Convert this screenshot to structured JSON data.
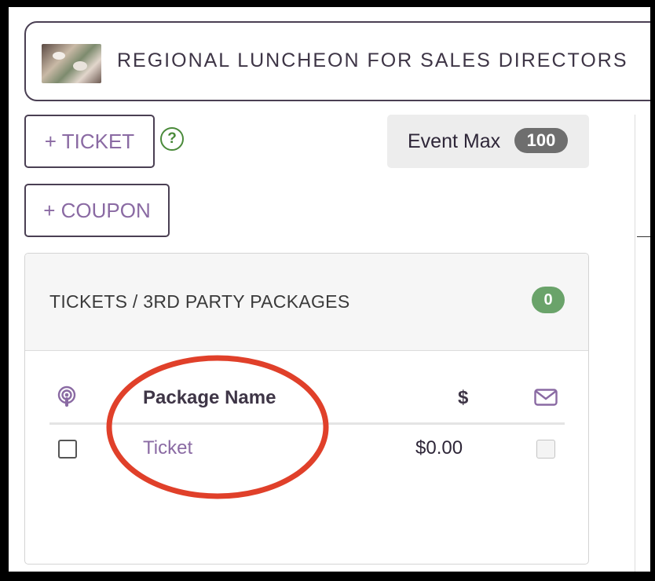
{
  "event": {
    "title": "REGIONAL LUNCHEON FOR SALES DIRECTORS",
    "thumbnail_icon": "event-photo"
  },
  "toolbar": {
    "add_ticket_label": "+ TICKET",
    "add_coupon_label": "+ COUPON",
    "help_label": "?",
    "event_max_label": "Event Max",
    "event_max_value": "100"
  },
  "tickets_panel": {
    "title": "TICKETS / 3RD PARTY PACKAGES",
    "count": "0",
    "columns": {
      "select_icon": "podcast-icon",
      "name": "Package Name",
      "price": "$",
      "email_icon": "envelope-icon"
    },
    "rows": [
      {
        "name": "Ticket",
        "price": "$0.00",
        "selected": false,
        "email": false
      }
    ]
  },
  "colors": {
    "accent_purple": "#8a6aa3",
    "border_dark": "#4a3f53",
    "badge_green": "#6aa36a",
    "help_green": "#4a8a3a",
    "annotation_red": "#e0402a"
  }
}
